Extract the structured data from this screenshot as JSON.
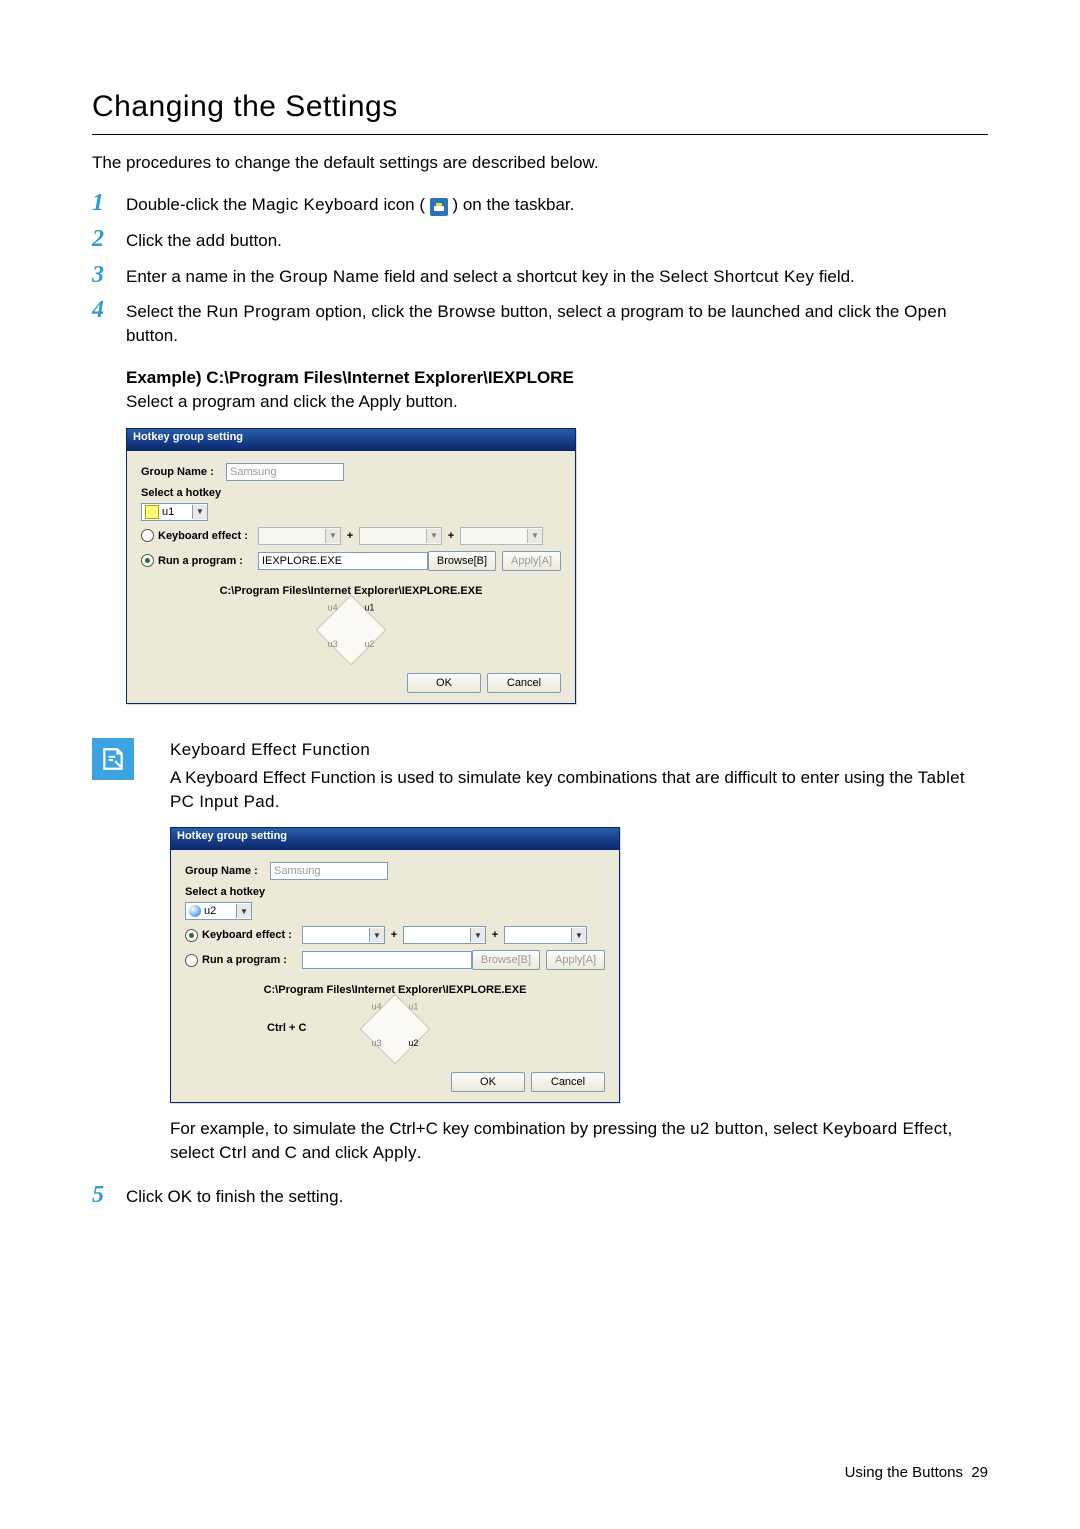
{
  "heading": "Changing the Settings",
  "intro": "The procedures to change the default settings are described below.",
  "steps": {
    "s1_a": "Double-click the ",
    "s1_b": "Magic Keyboard",
    "s1_c": " icon ( ",
    "s1_d": " ) on the taskbar.",
    "s2_a": "Click the ",
    "s2_b": "add",
    "s2_c": " button.",
    "s3_a": "Enter a name in the ",
    "s3_b": "Group Name",
    "s3_c": " field and select a shortcut key in the ",
    "s3_d": "Select Shortcut Key",
    "s3_e": " field.",
    "s4_a": "Select the ",
    "s4_b": "Run Program",
    "s4_c": " option, click the ",
    "s4_d": "Browse",
    "s4_e": " button, select a program to be launched and click the ",
    "s4_f": "Open",
    "s4_g": " button.",
    "s5": "Click OK to finish the setting."
  },
  "example_label": "Example) C:\\Program Files\\Internet Explorer\\IEXPLORE",
  "after_example": "Select a program and click the Apply button.",
  "dialog1": {
    "title": "Hotkey group setting",
    "group_label": "Group Name :",
    "group_value": "Samsung",
    "select_hotkey": "Select a hotkey",
    "hotkey_value": "u1",
    "keyboard_effect_label": "Keyboard effect :",
    "run_program_label": "Run a program :",
    "run_value": "IEXPLORE.EXE",
    "browse": "Browse[B]",
    "apply": "Apply[A]",
    "path": "C:\\Program Files\\Internet Explorer\\IEXPLORE.EXE",
    "u1": "u1",
    "u2": "u2",
    "u3": "u3",
    "u4": "u4",
    "ok": "OK",
    "cancel": "Cancel",
    "plus": "+"
  },
  "note": {
    "title": "Keyboard Effect Function",
    "body_a": "A Keyboard Effect Function is used to simulate key combinations that are difficult to enter using the ",
    "body_b": "Tablet PC Input Pad",
    "body_c": ".",
    "tail_a": "For example, to simulate the Ctrl+C key combination by pressing the ",
    "tail_b": "u2 button",
    "tail_c": ", select ",
    "tail_d": "Keyboard Effect",
    "tail_e": ", select ",
    "tail_f": "Ctrl",
    "tail_g": " and ",
    "tail_h": "C",
    "tail_i": " and click ",
    "tail_j": "Apply",
    "tail_k": "."
  },
  "dialog2": {
    "title": "Hotkey group setting",
    "group_label": "Group Name :",
    "group_value": "Samsung",
    "select_hotkey": "Select a hotkey",
    "hotkey_value": "u2",
    "keyboard_effect_label": "Keyboard effect :",
    "run_program_label": "Run a program :",
    "browse": "Browse[B]",
    "apply": "Apply[A]",
    "path": "C:\\Program Files\\Internet Explorer\\IEXPLORE.EXE",
    "u1": "u1",
    "u2": "u2",
    "u3": "u3",
    "u4": "u4",
    "annot": "Ctrl + C",
    "ok": "OK",
    "cancel": "Cancel",
    "plus": "+"
  },
  "footer_a": "Using the Buttons",
  "footer_b": "29"
}
